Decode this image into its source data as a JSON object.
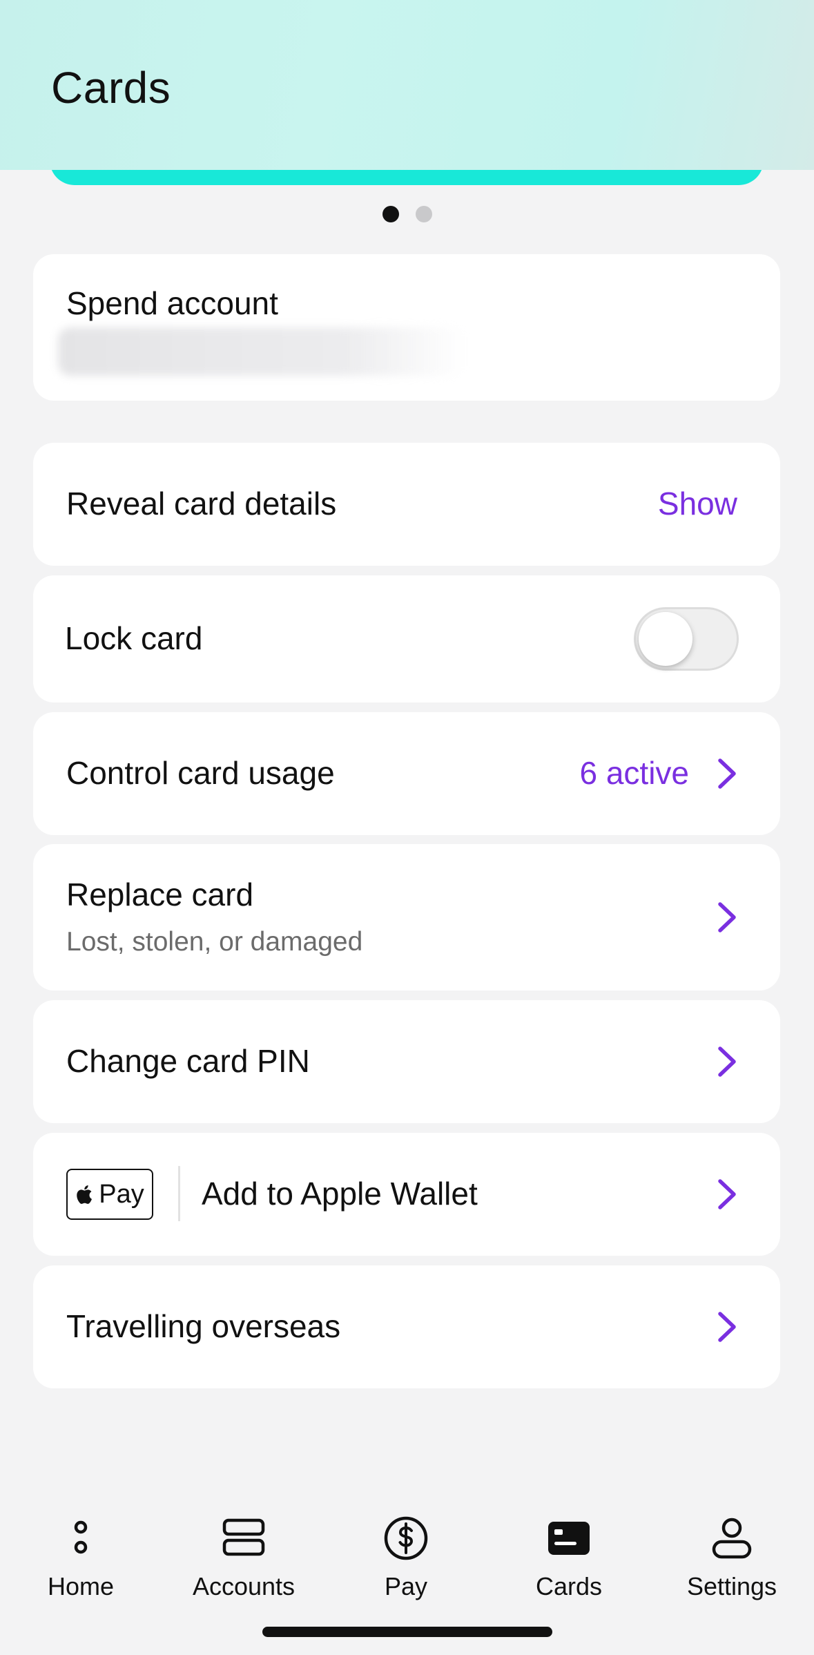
{
  "header": {
    "title": "Cards"
  },
  "carousel": {
    "pages": 2,
    "active_index": 0,
    "card_color": "#18e8d8"
  },
  "account": {
    "label": "Spend account"
  },
  "rows": {
    "reveal": {
      "label": "Reveal card details",
      "action": "Show"
    },
    "lock": {
      "label": "Lock card",
      "toggle_on": false
    },
    "usage": {
      "label": "Control card usage",
      "value": "6 active"
    },
    "replace": {
      "label": "Replace card",
      "subtitle": "Lost, stolen, or damaged"
    },
    "pin": {
      "label": "Change card PIN"
    },
    "wallet": {
      "badge": "Pay",
      "label": "Add to Apple Wallet"
    },
    "travel": {
      "label": "Travelling overseas"
    }
  },
  "colors": {
    "accent": "#7a2fe0",
    "header_bg": "#c6f1ec",
    "page_bg": "#f3f3f4"
  },
  "nav": {
    "items": [
      {
        "label": "Home",
        "icon": "home-dots-icon"
      },
      {
        "label": "Accounts",
        "icon": "accounts-stack-icon"
      },
      {
        "label": "Pay",
        "icon": "dollar-circle-icon"
      },
      {
        "label": "Cards",
        "icon": "card-icon",
        "active": true
      },
      {
        "label": "Settings",
        "icon": "person-icon"
      }
    ]
  }
}
